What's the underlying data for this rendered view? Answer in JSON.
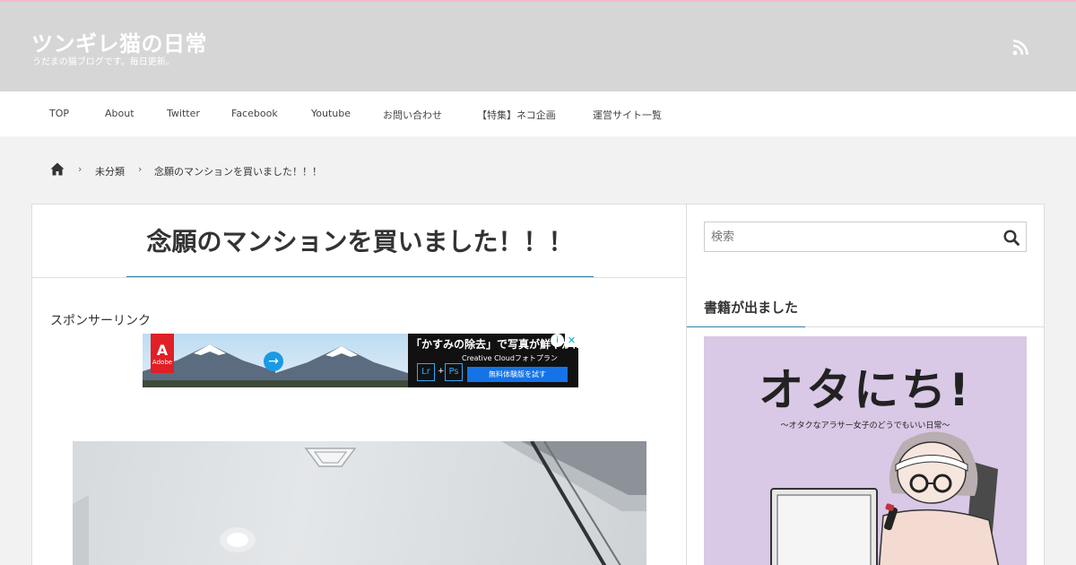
{
  "site": {
    "title": "ツンギレ猫の日常",
    "description": "うだまの猫ブログです。毎日更新。"
  },
  "nav": {
    "items": [
      "TOP",
      "About",
      "Twitter",
      "Facebook",
      "Youtube",
      "お問い合わせ",
      "【特集】ネコ企画",
      "運営サイト一覧"
    ]
  },
  "breadcrumb": {
    "category": "未分類",
    "current": "念願のマンションを買いました！！！"
  },
  "post": {
    "title": "念願のマンションを買いました！！！",
    "sponsor_label": "スポンサーリンク"
  },
  "ad": {
    "brand": "Adobe",
    "headline": "「かすみの除去」で写真が鮮やかに",
    "subline": "Creative Cloudフォトプラン",
    "lr": "Lr",
    "plus": "+",
    "ps": "Ps",
    "cta": "無料体験版を試す"
  },
  "sidebar": {
    "search_placeholder": "検索",
    "widget_title": "書籍が出ました",
    "book_title": "オタにち!",
    "book_subtitle": "〜オタクなアラサー女子のどうでもいい日常〜"
  },
  "colors": {
    "header_bg": "#d6d6d6",
    "accent": "#3a7fa5",
    "header_top_border": "#f5b8cb"
  }
}
